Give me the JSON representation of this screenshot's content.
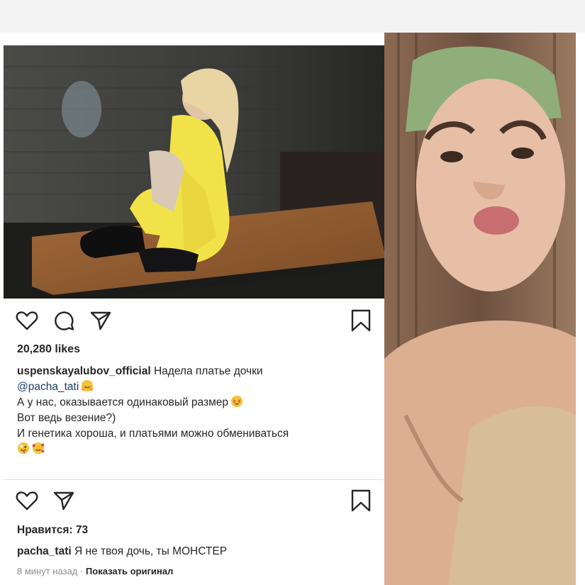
{
  "post": {
    "likes": "20,280 likes",
    "username": "uspenskayalubov_official",
    "caption_line1": "Надела платье дочки",
    "mention": "@pacha_tati",
    "caption_line2": "А у нас, оказывается одинаковый размер",
    "caption_line3": "Вот ведь везение?)",
    "caption_line4": "И генетика хороша, и платьями можно обмениваться"
  },
  "comment_section": {
    "likes": "Нравится: 73",
    "comment_user": "pacha_tati",
    "comment_text": "Я не твоя дочь, ты МОНСТЕР",
    "time": "8 минут назад",
    "separator": "·",
    "show_original": "Показать оригинал"
  },
  "icons": {
    "like": "heart-icon",
    "comment": "comment-icon",
    "share": "share-icon",
    "save": "bookmark-icon"
  },
  "colors": {
    "text": "#262626",
    "secondary": "#8e8e8e",
    "mention": "#1f3c68",
    "dress": "#f2e24a"
  }
}
